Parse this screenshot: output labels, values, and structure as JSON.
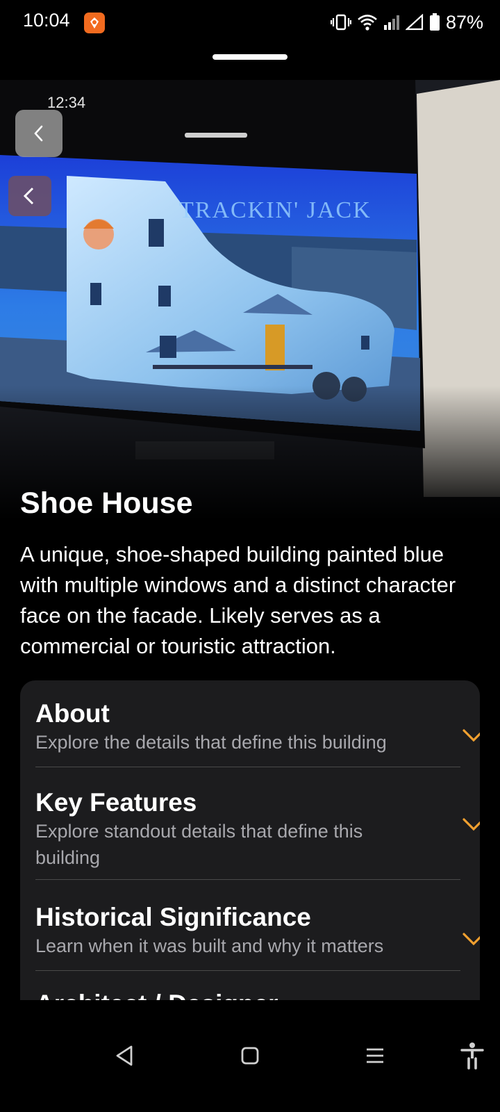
{
  "status_bar": {
    "time": "10:04",
    "battery_percent": "87%"
  },
  "back_button": {
    "icon": "chevron-left-icon"
  },
  "building": {
    "title": "Shoe House",
    "description": "A unique, shoe-shaped building painted blue with multiple windows and a distinct character face on the facade. Likely serves as a commercial or touristic attraction."
  },
  "photo": {
    "screen_time": "12:34",
    "sign_text": "TRACKIN' JACK"
  },
  "sections": [
    {
      "title": "About",
      "subtitle": "Explore the details that define this building"
    },
    {
      "title": "Key Features",
      "subtitle": "Explore standout details that define this building"
    },
    {
      "title": "Historical Significance",
      "subtitle": "Learn when it was built and why it matters"
    },
    {
      "title": "Architect / Designer",
      "subtitle": ""
    }
  ],
  "colors": {
    "accent": "#f0a030",
    "card_bg": "#1c1c1e",
    "subtitle": "#a8a8ad"
  },
  "nav": {
    "back": "triangle-back-icon",
    "home": "square-home-icon",
    "recents": "menu-icon",
    "accessibility": "accessibility-icon"
  }
}
